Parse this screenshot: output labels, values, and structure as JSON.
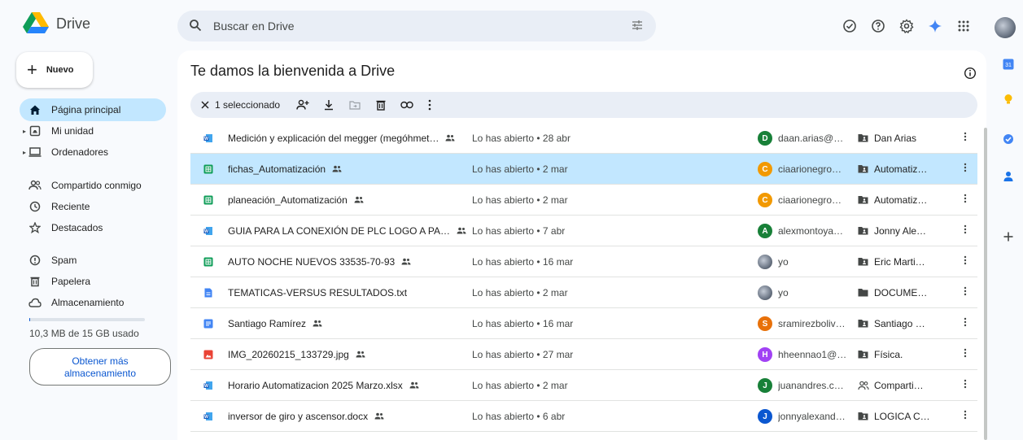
{
  "app": {
    "name": "Drive"
  },
  "search": {
    "placeholder": "Buscar en Drive"
  },
  "header_icons": [
    "tasks-check-icon",
    "help-icon",
    "settings-icon",
    "gemini-sparkle-icon",
    "apps-grid-icon"
  ],
  "sidebar": {
    "new_label": "Nuevo",
    "items": [
      {
        "label": "Página principal",
        "icon": "home-icon",
        "active": true
      },
      {
        "label": "Mi unidad",
        "icon": "my-drive-icon",
        "caret": true
      },
      {
        "label": "Ordenadores",
        "icon": "computer-icon",
        "caret": true
      },
      {
        "label": "Compartido conmigo",
        "icon": "shared-people-icon"
      },
      {
        "label": "Reciente",
        "icon": "clock-icon"
      },
      {
        "label": "Destacados",
        "icon": "star-icon"
      },
      {
        "label": "Spam",
        "icon": "spam-icon"
      },
      {
        "label": "Papelera",
        "icon": "trash-icon"
      },
      {
        "label": "Almacenamiento",
        "icon": "cloud-icon"
      }
    ],
    "storage_text": "10,3 MB de 15 GB usado",
    "storage_fraction": 0.0007,
    "get_storage_line1": "Obtener más",
    "get_storage_line2": "almacenamiento"
  },
  "main": {
    "title": "Te damos la bienvenida a Drive",
    "selection_count": "1 seleccionado"
  },
  "files": [
    {
      "name": "Medición y explicación del megger (megóhmet…",
      "type": "docx",
      "shared": true,
      "opened": "Lo has abierto • 28 abr",
      "owner_initial": "D",
      "owner_color": "#188038",
      "owner": "daan.arias@…",
      "location": "Dan Arias",
      "loc_icon": "shared-folder",
      "selected": false
    },
    {
      "name": "fichas_Automatización",
      "type": "sheet",
      "shared": true,
      "opened": "Lo has abierto • 2 mar",
      "owner_initial": "C",
      "owner_color": "#f29900",
      "owner": "ciaarionegro…",
      "location": "Automatiz…",
      "loc_icon": "shared-folder",
      "selected": true
    },
    {
      "name": "planeación_Automatización",
      "type": "sheet",
      "shared": true,
      "opened": "Lo has abierto • 2 mar",
      "owner_initial": "C",
      "owner_color": "#f29900",
      "owner": "ciaarionegro…",
      "location": "Automatiz…",
      "loc_icon": "shared-folder",
      "selected": false
    },
    {
      "name": "GUIA PARA LA CONEXIÓN DE PLC LOGO A PA…",
      "type": "docx",
      "shared": true,
      "opened": "Lo has abierto • 7 abr",
      "owner_initial": "A",
      "owner_color": "#188038",
      "owner": "alexmontoya…",
      "location": "Jonny Ale…",
      "loc_icon": "shared-folder",
      "selected": false
    },
    {
      "name": "AUTO NOCHE NUEVOS 33535-70-93",
      "type": "sheet",
      "shared": true,
      "opened": "Lo has abierto • 16 mar",
      "owner_initial": "",
      "owner_color": "#6c7685",
      "owner": "yo",
      "location": "Eric Marti…",
      "loc_icon": "shared-folder",
      "selected": false
    },
    {
      "name": "TEMATICAS-VERSUS RESULTADOS.txt",
      "type": "doc",
      "shared": false,
      "opened": "Lo has abierto • 2 mar",
      "owner_initial": "",
      "owner_color": "#6c7685",
      "owner": "yo",
      "location": "DOCUME…",
      "loc_icon": "folder",
      "selected": false
    },
    {
      "name": "Santiago Ramírez",
      "type": "gdoc",
      "shared": true,
      "opened": "Lo has abierto • 16 mar",
      "owner_initial": "S",
      "owner_color": "#e8710a",
      "owner": "sramirezboliv…",
      "location": "Santiago …",
      "loc_icon": "shared-folder",
      "selected": false
    },
    {
      "name": "IMG_20260215_133729.jpg",
      "type": "image",
      "shared": true,
      "opened": "Lo has abierto • 27 mar",
      "owner_initial": "H",
      "owner_color": "#a142f4",
      "owner": "hheennao1@…",
      "location": "Física.",
      "loc_icon": "shared-folder",
      "selected": false
    },
    {
      "name": "Horario Automatizacion 2025 Marzo.xlsx",
      "type": "docx",
      "shared": true,
      "opened": "Lo has abierto • 2 mar",
      "owner_initial": "J",
      "owner_color": "#188038",
      "owner": "juanandres.c…",
      "location": "Comparti…",
      "loc_icon": "shared-people",
      "selected": false
    },
    {
      "name": "inversor de giro y ascensor.docx",
      "type": "docx",
      "shared": true,
      "opened": "Lo has abierto • 6 abr",
      "owner_initial": "J",
      "owner_color": "#0b57d0",
      "owner": "jonnyalexand…",
      "location": "LOGICA C…",
      "loc_icon": "shared-folder",
      "selected": false
    }
  ],
  "right_rail": {
    "calendar_label": "31",
    "items": [
      "calendar-icon",
      "keep-icon",
      "tasks-icon",
      "contacts-icon",
      "add-icon"
    ]
  }
}
